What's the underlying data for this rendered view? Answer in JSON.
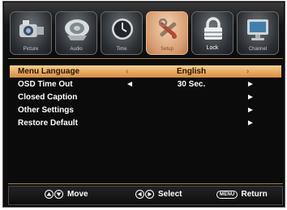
{
  "tabs": [
    {
      "label": "Picture",
      "icon": "camera-icon"
    },
    {
      "label": "Audio",
      "icon": "speaker-icon"
    },
    {
      "label": "Time",
      "icon": "clock-icon"
    },
    {
      "label": "Setup",
      "icon": "tools-icon"
    },
    {
      "label": "Lock",
      "icon": "padlock-icon"
    },
    {
      "label": "Channel",
      "icon": "monitor-icon"
    }
  ],
  "menu": [
    {
      "name": "Menu Language",
      "left_arrow": "‹",
      "value": "English",
      "right_arrow": "›",
      "highlighted": true
    },
    {
      "name": "OSD Time Out",
      "left_arrow": "◄",
      "value": "30 Sec.",
      "right_arrow": "►"
    },
    {
      "name": "Closed Caption",
      "left_arrow": "",
      "value": "",
      "right_arrow": "►"
    },
    {
      "name": "Other Settings",
      "left_arrow": "",
      "value": "",
      "right_arrow": "►"
    },
    {
      "name": "Restore Default",
      "left_arrow": "",
      "value": "",
      "right_arrow": "►"
    }
  ],
  "hints": {
    "move": "Move",
    "select": "Select",
    "menu_key": "MENU",
    "return": "Return"
  },
  "colors": {
    "highlight": "#e7a95f",
    "accent_line": "#a5814f",
    "background": "#0d0d0d"
  }
}
